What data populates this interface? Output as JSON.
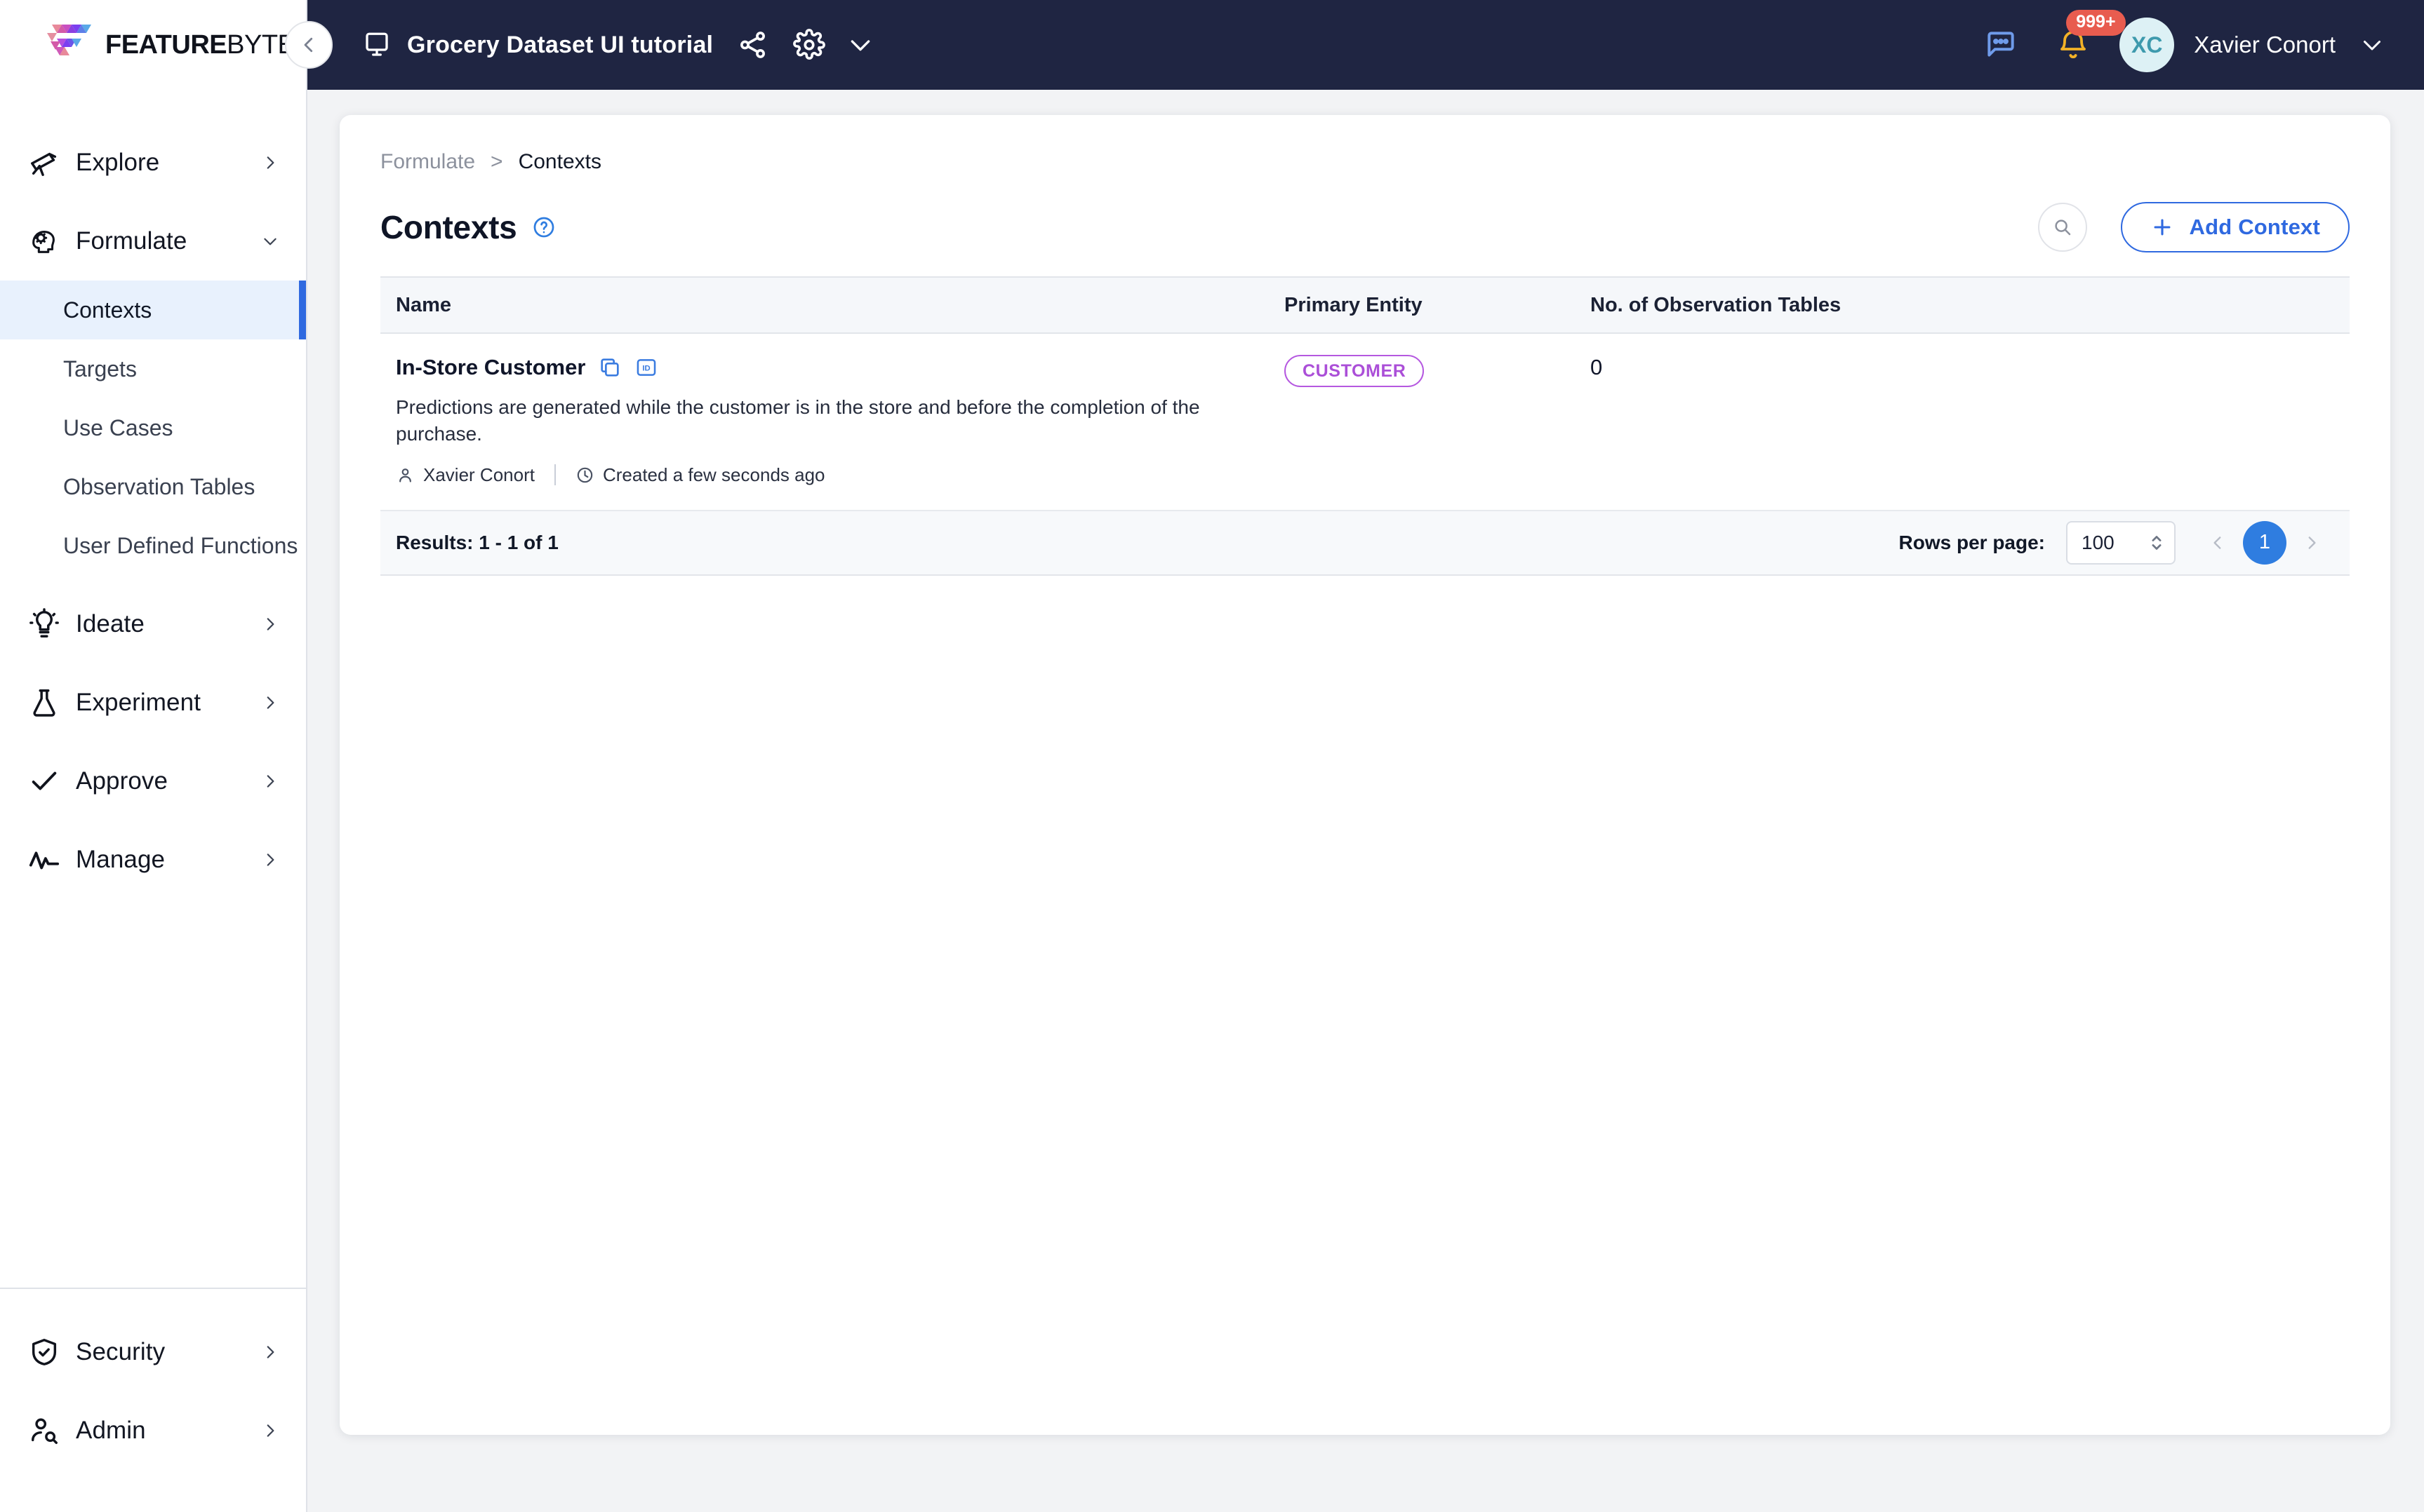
{
  "brand": {
    "name_bold": "FEATURE",
    "name_light": "BYTE"
  },
  "topbar": {
    "project_title": "Grocery Dataset UI tutorial",
    "screen_icon": "monitor-icon",
    "share_icon": "share-icon",
    "settings_icon": "gear-icon",
    "caret_icon": "chevron-down-icon",
    "chat_icon": "chat-bubble-icon",
    "bell_icon": "bell-icon",
    "notification_count": "999+",
    "avatar_initials": "XC",
    "user_name": "Xavier Conort",
    "accent_badge_color": "#e85c4f",
    "bar_color": "#1f2542"
  },
  "sidebar": {
    "collapse_icon": "chevron-left-icon",
    "groups": [
      {
        "label": "Explore",
        "icon": "telescope-icon",
        "expanded": false
      },
      {
        "label": "Formulate",
        "icon": "brain-gear-icon",
        "expanded": true
      }
    ],
    "formulate_items": [
      {
        "label": "Contexts",
        "active": true
      },
      {
        "label": "Targets",
        "active": false
      },
      {
        "label": "Use Cases",
        "active": false
      },
      {
        "label": "Observation Tables",
        "active": false
      },
      {
        "label": "User Defined Functions",
        "active": false
      }
    ],
    "groups_after": [
      {
        "label": "Ideate",
        "icon": "lightbulb-icon"
      },
      {
        "label": "Experiment",
        "icon": "flask-icon"
      },
      {
        "label": "Approve",
        "icon": "check-icon"
      },
      {
        "label": "Manage",
        "icon": "activity-pulse-icon"
      }
    ],
    "bottom_items": [
      {
        "label": "Security",
        "icon": "shield-check-icon"
      },
      {
        "label": "Admin",
        "icon": "user-search-icon"
      }
    ],
    "active_color": "#2f69e0",
    "active_bg": "#e8f1fd"
  },
  "breadcrumb": {
    "parent": "Formulate",
    "separator": ">",
    "current": "Contexts"
  },
  "page": {
    "title": "Contexts",
    "help_icon": "question-circle-icon",
    "search_icon": "search-icon",
    "add_button_label": "Add Context",
    "add_button_icon": "plus-icon",
    "accent_color": "#2f69e0"
  },
  "table": {
    "columns": [
      "Name",
      "Primary Entity",
      "No. of Observation Tables"
    ],
    "rows": [
      {
        "name": "In-Store Customer",
        "copy_icon": "copy-icon",
        "id_icon": "id-badge-icon",
        "description": "Predictions are generated while the customer is in the store and before the completion of the purchase.",
        "author_icon": "user-icon",
        "author": "Xavier Conort",
        "time_icon": "clock-icon",
        "created": "Created a few seconds ago",
        "primary_entity": "CUSTOMER",
        "entity_color": "#ab4fd8",
        "observation_tables": "0"
      }
    ]
  },
  "footer": {
    "results": "Results: 1 - 1 of 1",
    "rows_per_page_label": "Rows per page:",
    "rows_per_page_value": "100",
    "rows_per_page_options": [
      "100"
    ],
    "prev_icon": "chevron-left-icon",
    "next_icon": "chevron-right-icon",
    "current_page": "1"
  }
}
